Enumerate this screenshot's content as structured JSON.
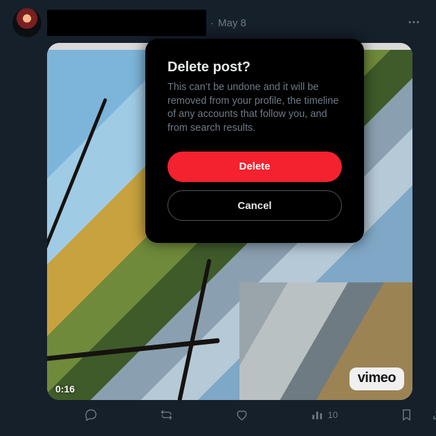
{
  "post": {
    "date": "May 8",
    "video_duration": "0:16",
    "watermark": "vimeo",
    "views": "10"
  },
  "modal": {
    "title": "Delete post?",
    "body": "This can’t be undone and it will be removed from your profile, the timeline of any accounts that follow you, and from search results.",
    "delete_label": "Delete",
    "cancel_label": "Cancel"
  }
}
